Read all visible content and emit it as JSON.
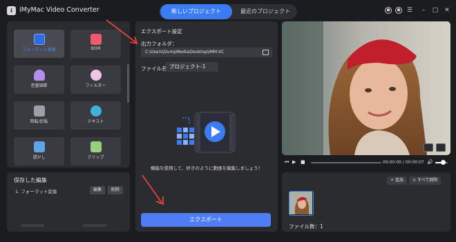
{
  "app": {
    "title": "iMyMac Video Converter",
    "logo_letter": "i"
  },
  "tabs": [
    {
      "label": "新しいプロジェクト",
      "active": true
    },
    {
      "label": "最近のプロジェクト",
      "active": false
    }
  ],
  "window_controls": [
    "user-icon",
    "settings-icon",
    "menu-icon",
    "minimize-icon",
    "maximize-icon",
    "close-icon"
  ],
  "tools": [
    {
      "label": "フォーマット変換",
      "icon": "format-convert-icon",
      "active": true,
      "color": "#4b8bff"
    },
    {
      "label": "BGM",
      "icon": "bgm-icon",
      "active": false,
      "color": "#f05a6a"
    },
    {
      "label": "音量調節",
      "icon": "volume-icon",
      "active": false,
      "color": "#b58cf0"
    },
    {
      "label": "フィルター",
      "icon": "filter-icon",
      "active": false,
      "color": "#f0c6e6"
    },
    {
      "label": "回転/反転",
      "icon": "rotate-icon",
      "active": false,
      "color": "#9aa0a6"
    },
    {
      "label": "テキスト",
      "icon": "text-icon",
      "active": false,
      "color": "#3fb0e0"
    },
    {
      "label": "透かし",
      "icon": "watermark-icon",
      "active": false,
      "color": "#5fa6e8"
    },
    {
      "label": "クリップ",
      "icon": "clip-icon",
      "active": false,
      "color": "#9ad07a"
    }
  ],
  "saved": {
    "title": "保存した編集",
    "item": "1.  フォーマット変換",
    "edit_label": "編集",
    "delete_label": "削除"
  },
  "export": {
    "heading": "エクスポート設定",
    "folder_label": "出力フォルダ：",
    "folder_path": "C:\\Users\\DumpMedia\\Desktop\\IMM-VC",
    "filename_label": "ファイル名：",
    "filename_value": "プロジェクト-1",
    "hint": "機能を使用して、好きのように動画を編集しましょう！",
    "button_label": "エクスポート"
  },
  "player": {
    "time": "00:00:00 / 00:00:07",
    "progress": 0,
    "volume": 0.6
  },
  "media": {
    "add_label": "+ 追加",
    "delete_all_label": "× すべて削除",
    "file_count": "ファイル数：1"
  },
  "colors": {
    "accent": "#3b7cf5",
    "export_button": "#4f7df5",
    "annotation_arrow": "#e8423a"
  }
}
